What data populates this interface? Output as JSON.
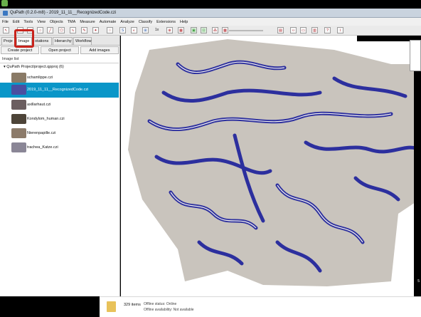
{
  "window": {
    "title": "QuPath (0.2.0-m8) - 2019_11_11__RecognizedCode.czi"
  },
  "menu": [
    "File",
    "Edit",
    "Tools",
    "View",
    "Objects",
    "TMA",
    "Measure",
    "Automate",
    "Analyze",
    "Classify",
    "Extensions",
    "Help"
  ],
  "toolbar": {
    "zoom_text": "1x",
    "s_label": "S"
  },
  "tabs": [
    {
      "label": "Proje"
    },
    {
      "label": "Image"
    },
    {
      "label": "otations"
    },
    {
      "label": "Hierarchy"
    },
    {
      "label": "Workflow"
    }
  ],
  "buttons": {
    "create_project": "Create project",
    "open_project": "Open project",
    "add_images": "Add images"
  },
  "image_list": {
    "label": "Image list",
    "root": "▾ QuPath Project/project.qpproj (6)",
    "items": [
      {
        "name": "schamlippe.czi",
        "selected": false,
        "thumb_color": "#8a7a66"
      },
      {
        "name": "2019_11_11__RecognizedCode.czi",
        "selected": true,
        "thumb_color": "#4a4fa0"
      },
      {
        "name": "axillarhaut.czi",
        "selected": false,
        "thumb_color": "#6b5e60"
      },
      {
        "name": "Kondylom_human.czi",
        "selected": false,
        "thumb_color": "#4d4438"
      },
      {
        "name": "Nierenpapille.czi",
        "selected": false,
        "thumb_color": "#8c7b6a"
      },
      {
        "name": "trachea_Katze.czi",
        "selected": false,
        "thumb_color": "#8a8696"
      }
    ]
  },
  "viewer": {
    "scale_text": "5"
  },
  "explorer_status": {
    "count": "329 items",
    "offline_status_label": "Offline status:",
    "offline_status_value": "Online",
    "offline_avail_label": "Offline availability:",
    "offline_avail_value": "Not available"
  },
  "colors": {
    "selection": "#0a96c8",
    "highlight": "#c8231c",
    "tissue_blue": "#2c2f9e",
    "tissue_bg": "#c9c4bd"
  }
}
